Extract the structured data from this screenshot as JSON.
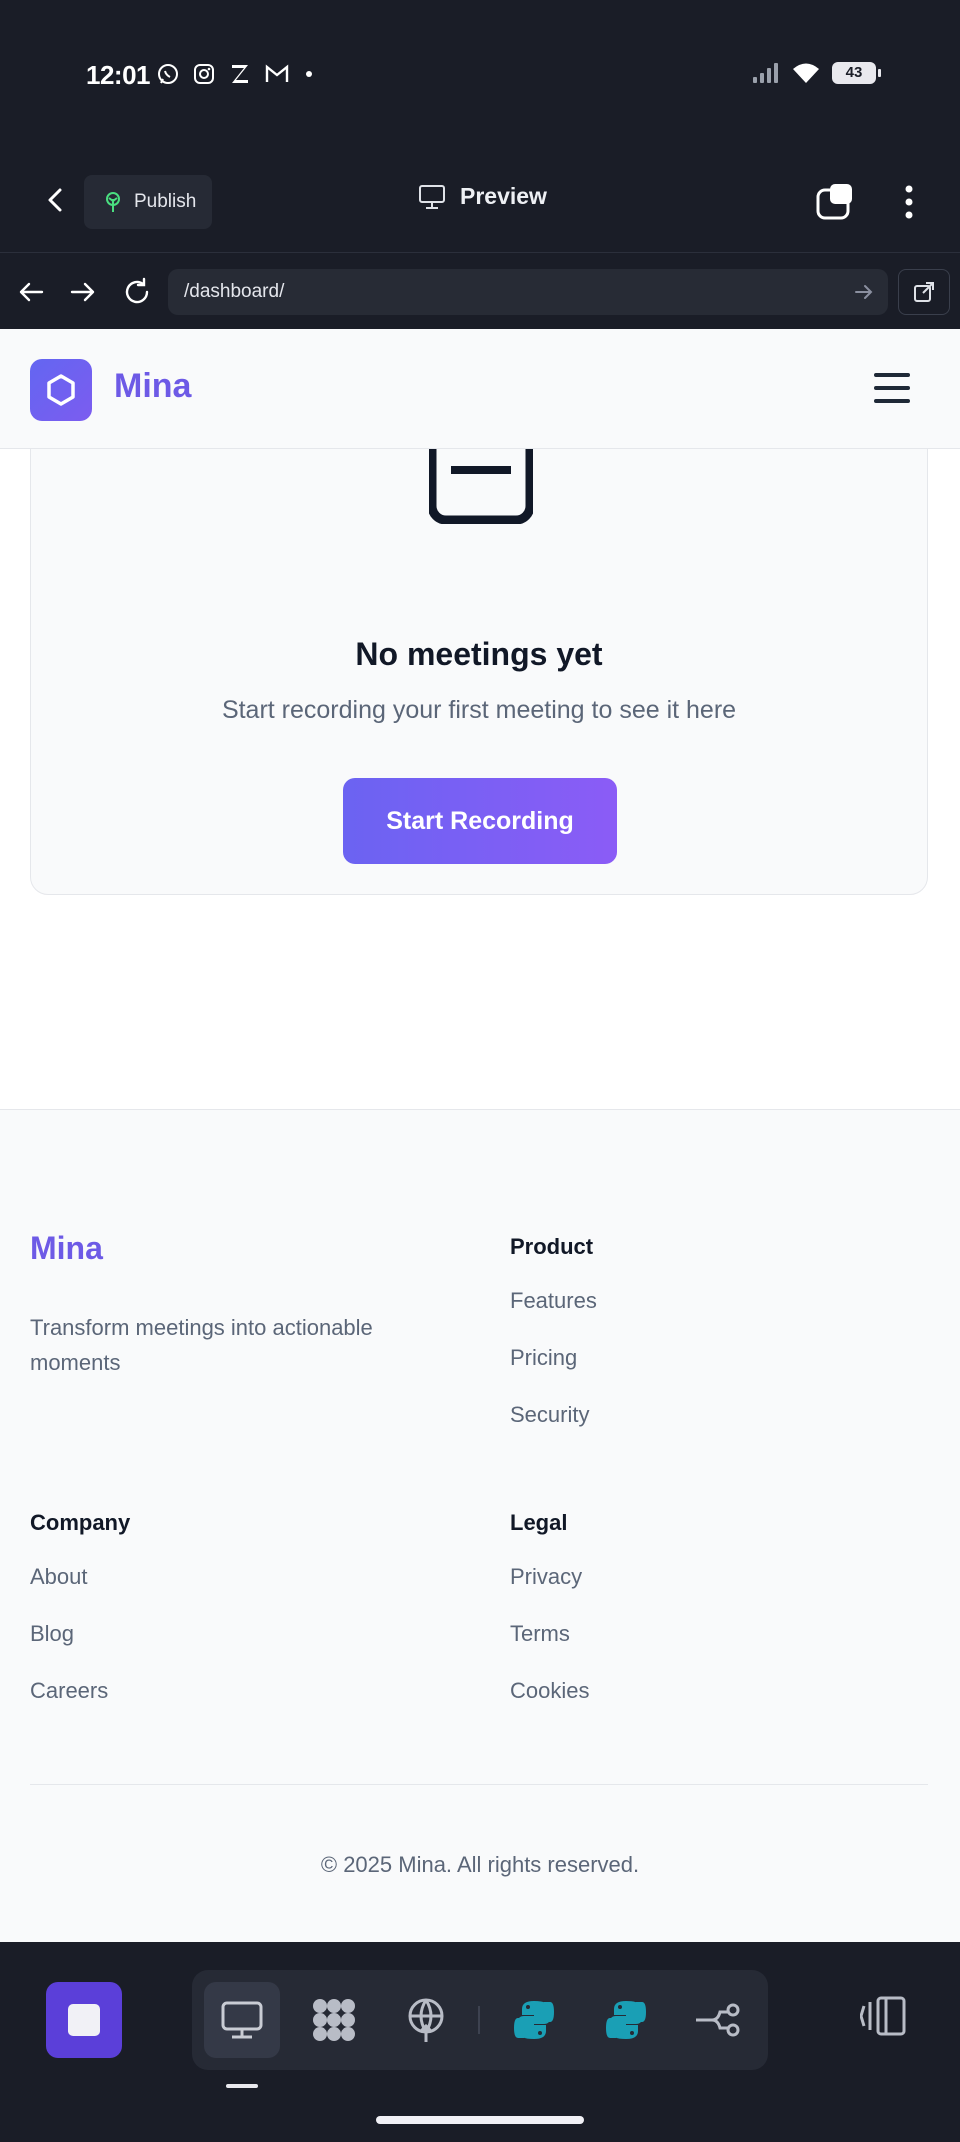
{
  "status_bar": {
    "time": "12:01",
    "battery": "43",
    "notification_icons": [
      "whatsapp-icon",
      "instagram-icon",
      "z-app-icon",
      "gmail-icon",
      "dot-icon"
    ],
    "system_icons": [
      "signal-icon",
      "wifi-icon",
      "battery-icon"
    ]
  },
  "editor": {
    "publish_label": "Publish",
    "preview_label": "Preview"
  },
  "browser": {
    "url": "/dashboard/"
  },
  "app": {
    "brand": "Mina",
    "accent_color": "#6d5ae6",
    "empty_state": {
      "title": "No meetings yet",
      "subtitle": "Start recording your first meeting to see it here",
      "button_label": "Start Recording"
    },
    "footer": {
      "brand": "Mina",
      "tagline": "Transform meetings into actionable moments",
      "columns": [
        {
          "heading": "Product",
          "links": [
            "Features",
            "Pricing",
            "Security"
          ]
        },
        {
          "heading": "Company",
          "links": [
            "About",
            "Blog",
            "Careers"
          ]
        },
        {
          "heading": "Legal",
          "links": [
            "Privacy",
            "Terms",
            "Cookies"
          ]
        }
      ],
      "copyright": "© 2025 Mina. All rights reserved."
    }
  },
  "dock": {
    "tools": [
      "desktop-icon",
      "grid-blob-icon",
      "globe-icon",
      "python-icon",
      "python-icon",
      "branch-icon"
    ],
    "active_tool": "desktop-icon"
  }
}
